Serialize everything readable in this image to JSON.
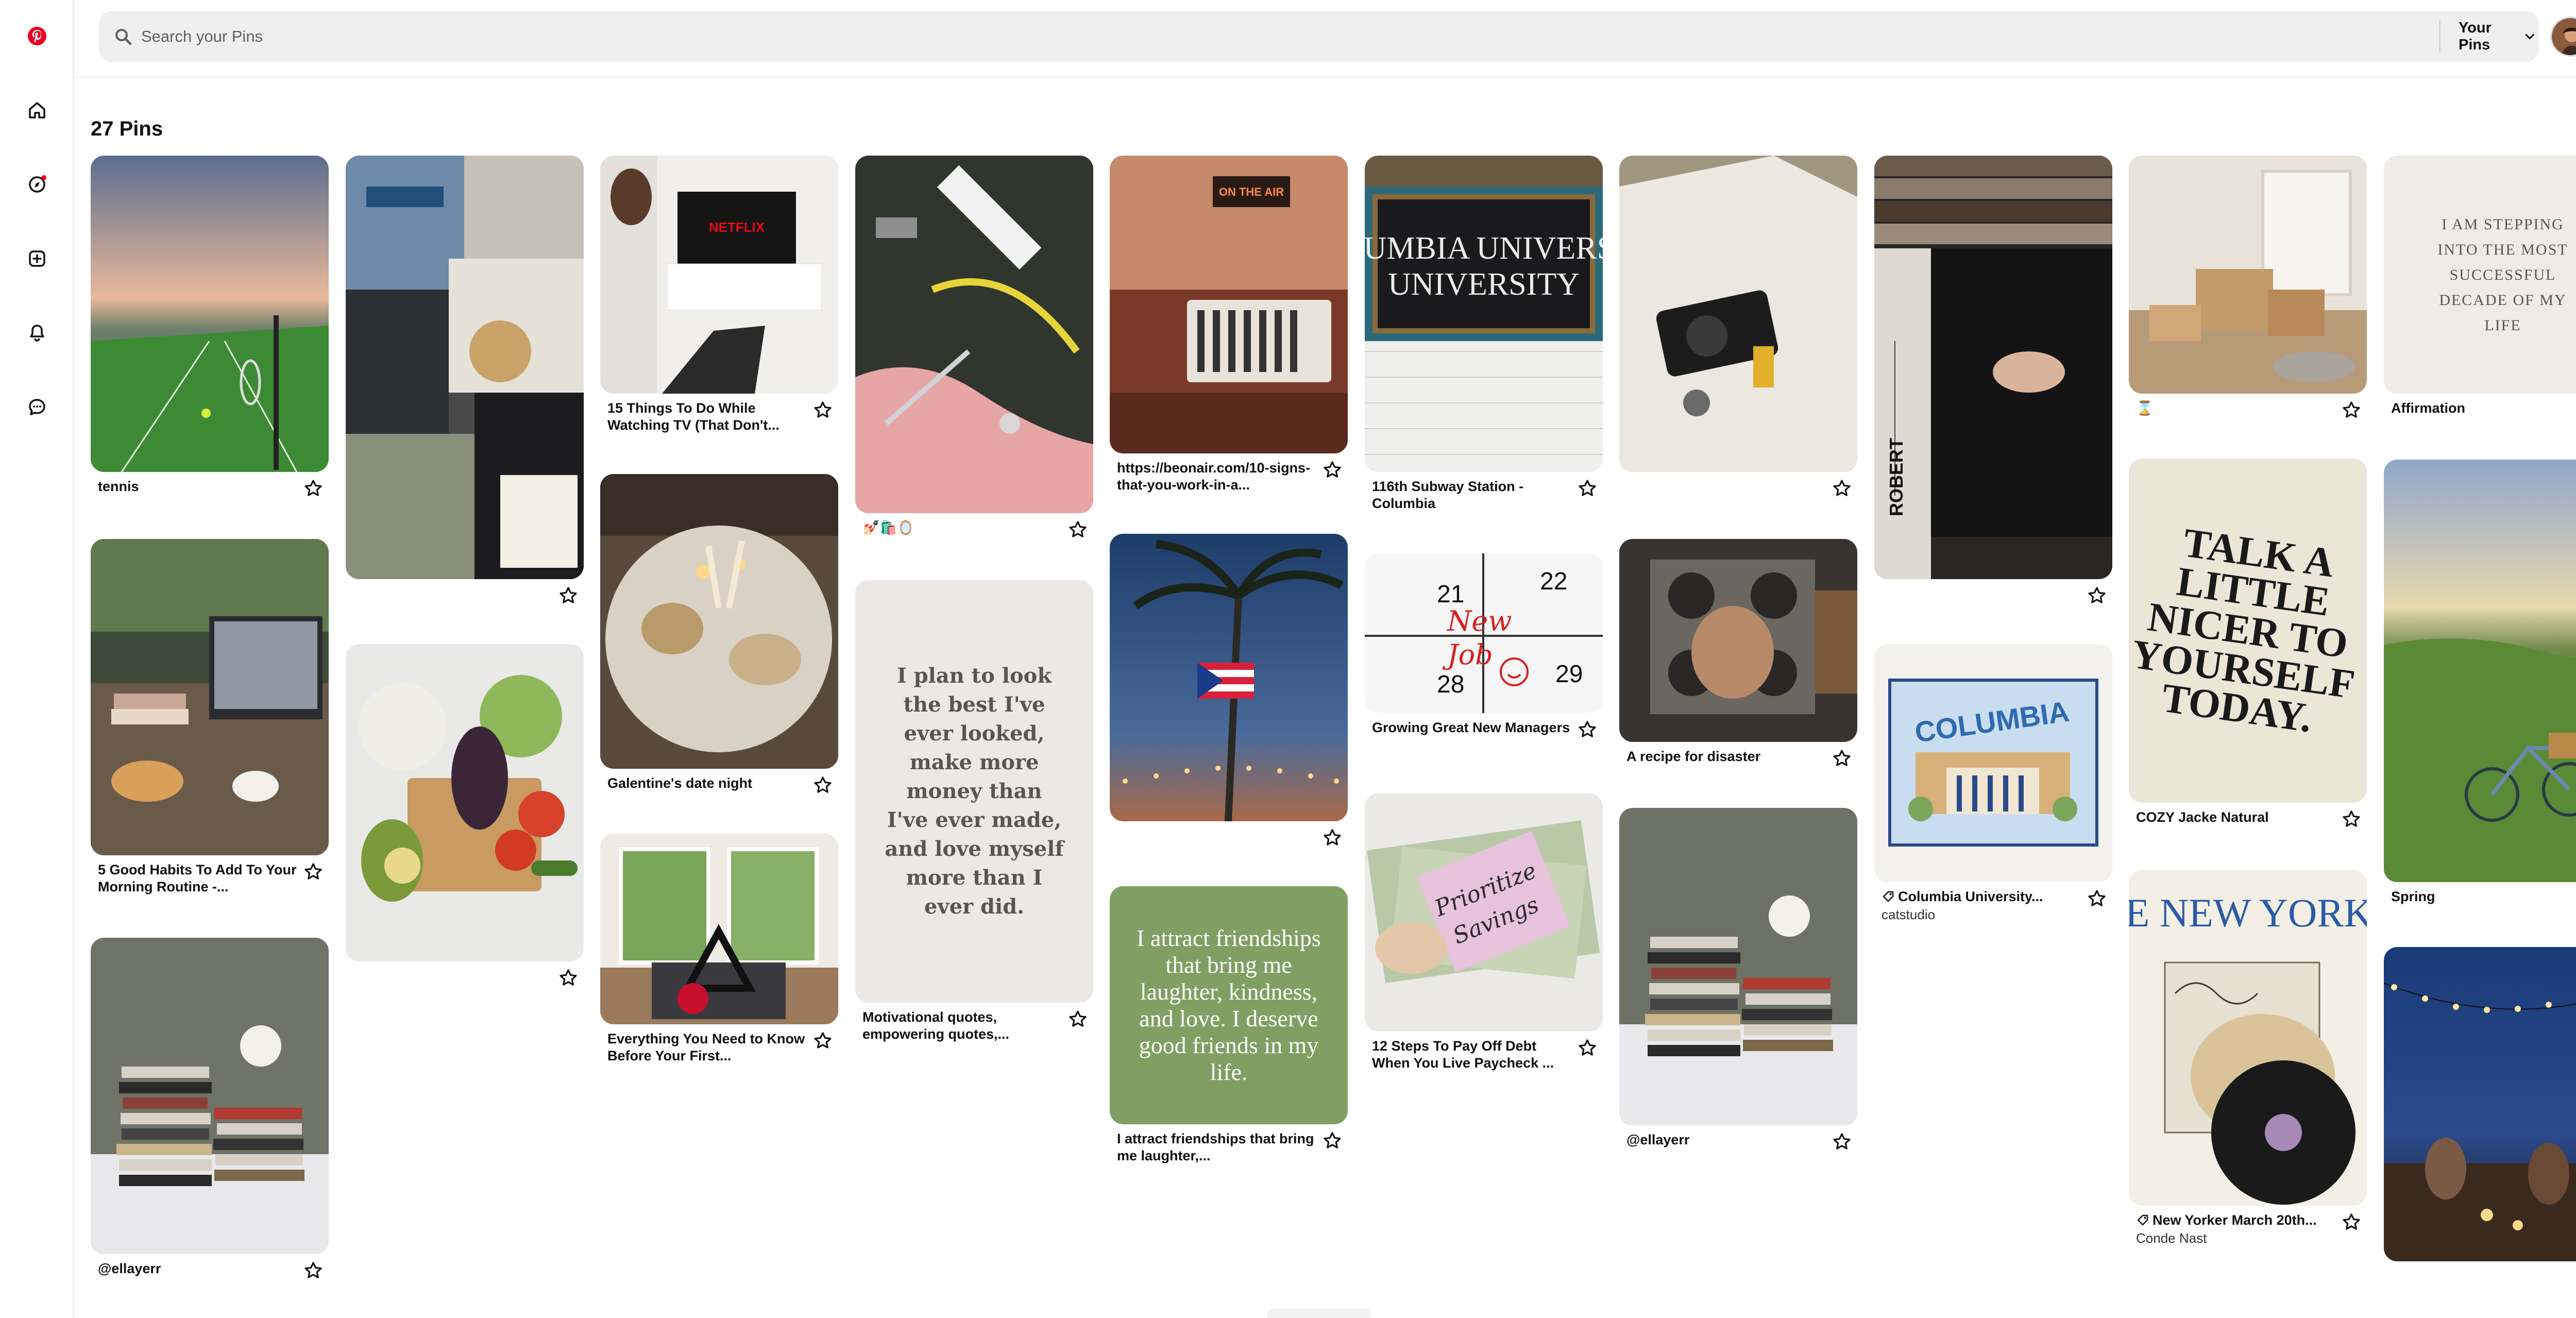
{
  "app": {
    "name": "Pinterest",
    "brand_color": "#e60023"
  },
  "search": {
    "placeholder": "Search your Pins"
  },
  "header": {
    "your_pins_label": "Your Pins"
  },
  "board": {
    "pin_count": "27 Pins"
  },
  "rail": {
    "icons": [
      "pinterest-logo-icon",
      "home-icon",
      "explore-icon",
      "create-icon",
      "notifications-icon",
      "messages-icon"
    ],
    "explore_has_dot": true
  },
  "pins": [
    {
      "title": "tennis"
    },
    {
      "title": ""
    },
    {
      "title": "@ellayerr"
    },
    {
      "title": "5 Good Habits To Add To Your Morning Routine -..."
    },
    {
      "title": ""
    },
    {
      "title": "15 Things To Do While Watching TV (That Don't..."
    },
    {
      "title": "Galentine's date night"
    },
    {
      "title": "Everything You Need to Know Before Your First..."
    },
    {
      "title": "💅🏻🛍️🪞"
    },
    {
      "title": "Motivational quotes, empowering quotes,...",
      "quote": "I plan to look the best I've ever looked, make more money than I've ever made, and love myself more than I ever did."
    },
    {
      "title": "https://beonair.com/10-signs-that-you-work-in-a..."
    },
    {
      "title": ""
    },
    {
      "title": "I attract friendships that bring me laughter,...",
      "quote": "I attract friendships that bring me laughter, kindness, and love. I deserve good friends in my life."
    },
    {
      "title": "116th Subway Station - Columbia",
      "image_text": "COLUMBIA UNIVERSITY"
    },
    {
      "title": "Growing Great New Managers",
      "image_text": [
        "21",
        "22",
        "28",
        "29",
        "New",
        "Job"
      ]
    },
    {
      "title": "12 Steps To Pay Off Debt When You Live Paycheck ...",
      "image_text": [
        "Prioritize",
        "Savings"
      ]
    },
    {
      "title": ""
    },
    {
      "title": "A recipe for disaster"
    },
    {
      "title": "@ellayerr"
    },
    {
      "title": ""
    },
    {
      "title": "Columbia University...",
      "subtitle": "catstudio"
    },
    {
      "title": "⌛"
    },
    {
      "title": "COZY Jacke Natural",
      "quote": "TALK A LITTLE NICER TO YOURSELF TODAY."
    },
    {
      "title": "New Yorker March 20th...",
      "subtitle": "Conde Nast",
      "image_text": "THE NEW YORKER"
    },
    {
      "title": "Affirmation",
      "quote": "I AM STEPPING INTO THE MOST SUCCESSFUL DECADE OF MY LIFE"
    },
    {
      "title": "Spring"
    },
    {
      "title": ""
    }
  ]
}
